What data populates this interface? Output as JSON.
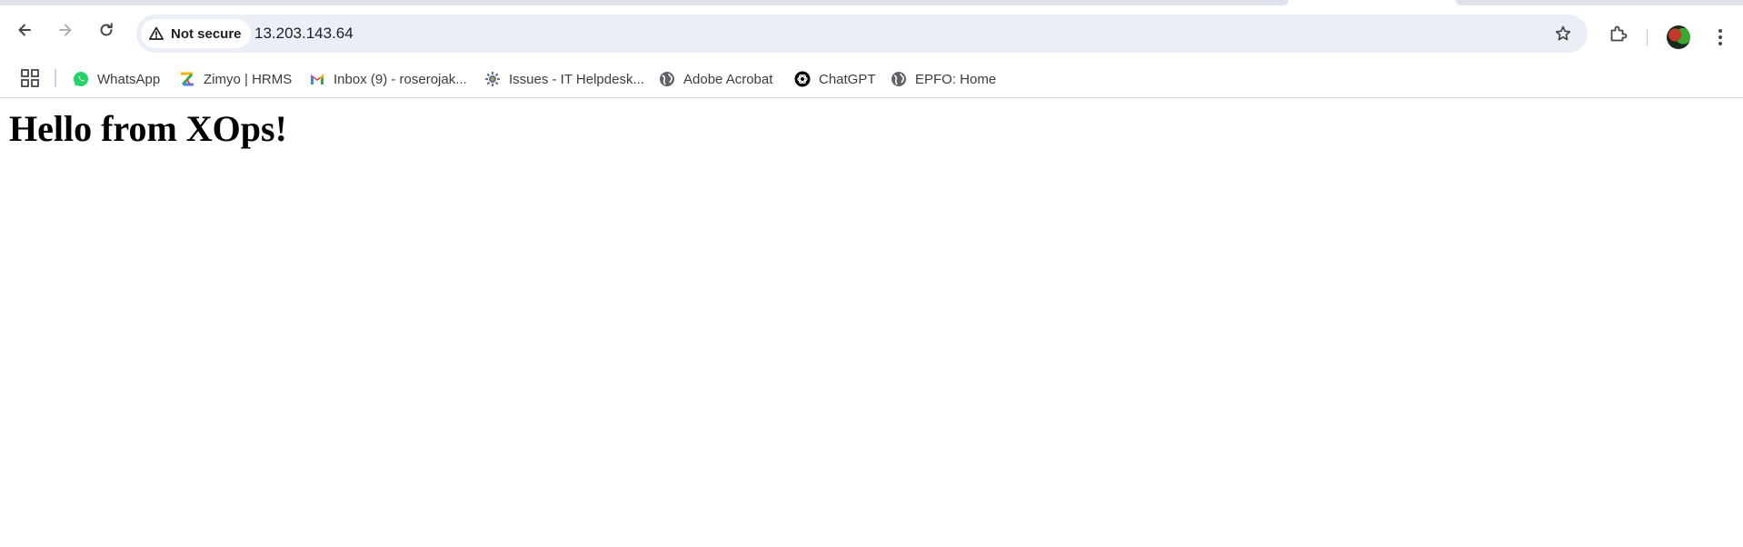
{
  "browser": {
    "address_bar": {
      "security_label": "Not secure",
      "url": "13.203.143.64"
    },
    "icons": {
      "back": "arrow-left-icon",
      "forward": "arrow-right-icon",
      "reload": "reload-icon",
      "warning": "warning-triangle-icon",
      "bookmark": "star-icon",
      "extensions": "puzzle-icon",
      "menu": "vertical-dots-icon",
      "apps": "apps-grid-icon"
    },
    "colors": {
      "omnibox_bg": "#eaeff7",
      "tabstrip_bg": "#dde3ea"
    }
  },
  "bookmarks": [
    {
      "label": "WhatsApp",
      "icon": "whatsapp-icon"
    },
    {
      "label": "Zimyo | HRMS",
      "icon": "zimyo-icon"
    },
    {
      "label": "Inbox (9) - roserojak...",
      "icon": "gmail-icon"
    },
    {
      "label": "Issues - IT Helpdesk...",
      "icon": "helpdesk-icon"
    },
    {
      "label": "Adobe Acrobat",
      "icon": "globe-icon"
    },
    {
      "label": "ChatGPT",
      "icon": "chatgpt-icon"
    },
    {
      "label": "EPFO: Home",
      "icon": "globe-icon"
    }
  ],
  "page": {
    "heading": "Hello from XOps!"
  }
}
